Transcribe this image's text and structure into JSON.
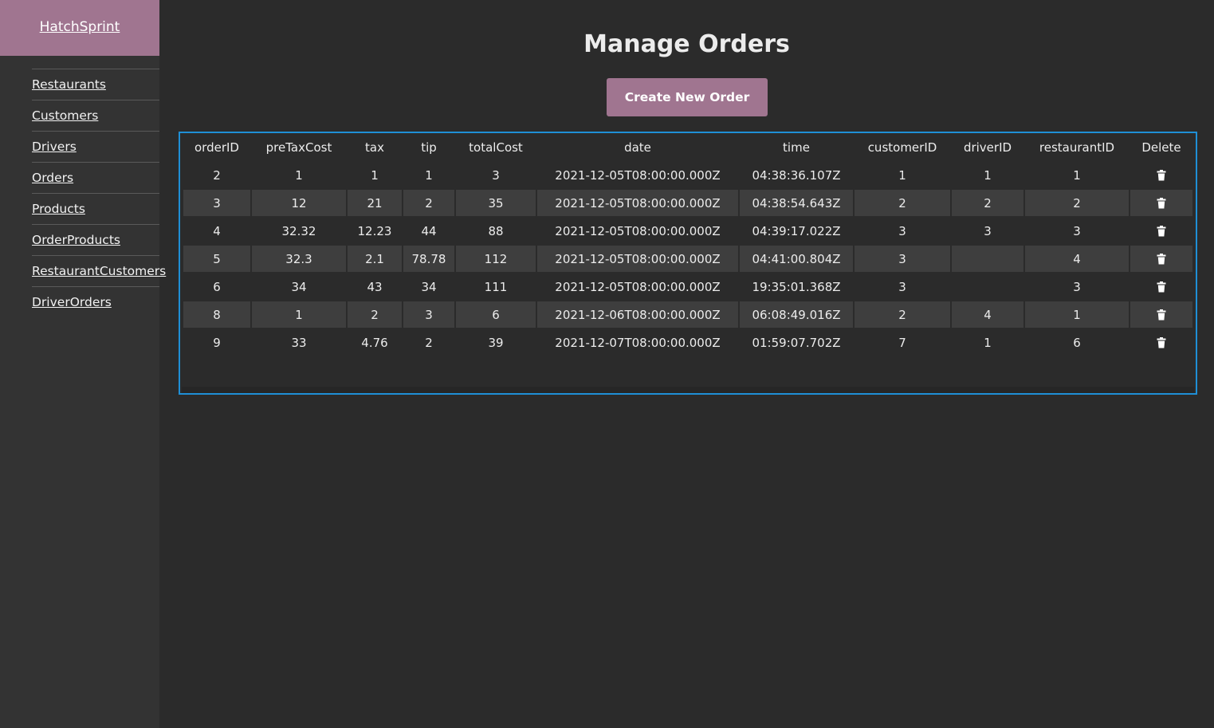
{
  "app": {
    "brand": "HatchSprint"
  },
  "sidebar": {
    "items": [
      {
        "label": "Restaurants"
      },
      {
        "label": "Customers"
      },
      {
        "label": "Drivers"
      },
      {
        "label": "Orders"
      },
      {
        "label": "Products"
      },
      {
        "label": "OrderProducts"
      },
      {
        "label": "RestaurantCustomers"
      },
      {
        "label": "DriverOrders"
      }
    ]
  },
  "main": {
    "title": "Manage Orders",
    "create_button": "Create New Order"
  },
  "colors": {
    "accent": "#a07590",
    "table_border": "#1f8fd6",
    "background": "#2b2b2b",
    "sidebar": "#333333"
  },
  "table": {
    "columns": [
      "orderID",
      "preTaxCost",
      "tax",
      "tip",
      "totalCost",
      "date",
      "time",
      "customerID",
      "driverID",
      "restaurantID",
      "Delete"
    ],
    "delete_icon": "trash-icon",
    "rows": [
      [
        "2",
        "1",
        "1",
        "1",
        "3",
        "2021-12-05T08:00:00.000Z",
        "04:38:36.107Z",
        "1",
        "1",
        "1"
      ],
      [
        "3",
        "12",
        "21",
        "2",
        "35",
        "2021-12-05T08:00:00.000Z",
        "04:38:54.643Z",
        "2",
        "2",
        "2"
      ],
      [
        "4",
        "32.32",
        "12.23",
        "44",
        "88",
        "2021-12-05T08:00:00.000Z",
        "04:39:17.022Z",
        "3",
        "3",
        "3"
      ],
      [
        "5",
        "32.3",
        "2.1",
        "78.78",
        "112",
        "2021-12-05T08:00:00.000Z",
        "04:41:00.804Z",
        "3",
        "",
        "4"
      ],
      [
        "6",
        "34",
        "43",
        "34",
        "111",
        "2021-12-05T08:00:00.000Z",
        "19:35:01.368Z",
        "3",
        "",
        "3"
      ],
      [
        "8",
        "1",
        "2",
        "3",
        "6",
        "2021-12-06T08:00:00.000Z",
        "06:08:49.016Z",
        "2",
        "4",
        "1"
      ],
      [
        "9",
        "33",
        "4.76",
        "2",
        "39",
        "2021-12-07T08:00:00.000Z",
        "01:59:07.702Z",
        "7",
        "1",
        "6"
      ]
    ]
  }
}
